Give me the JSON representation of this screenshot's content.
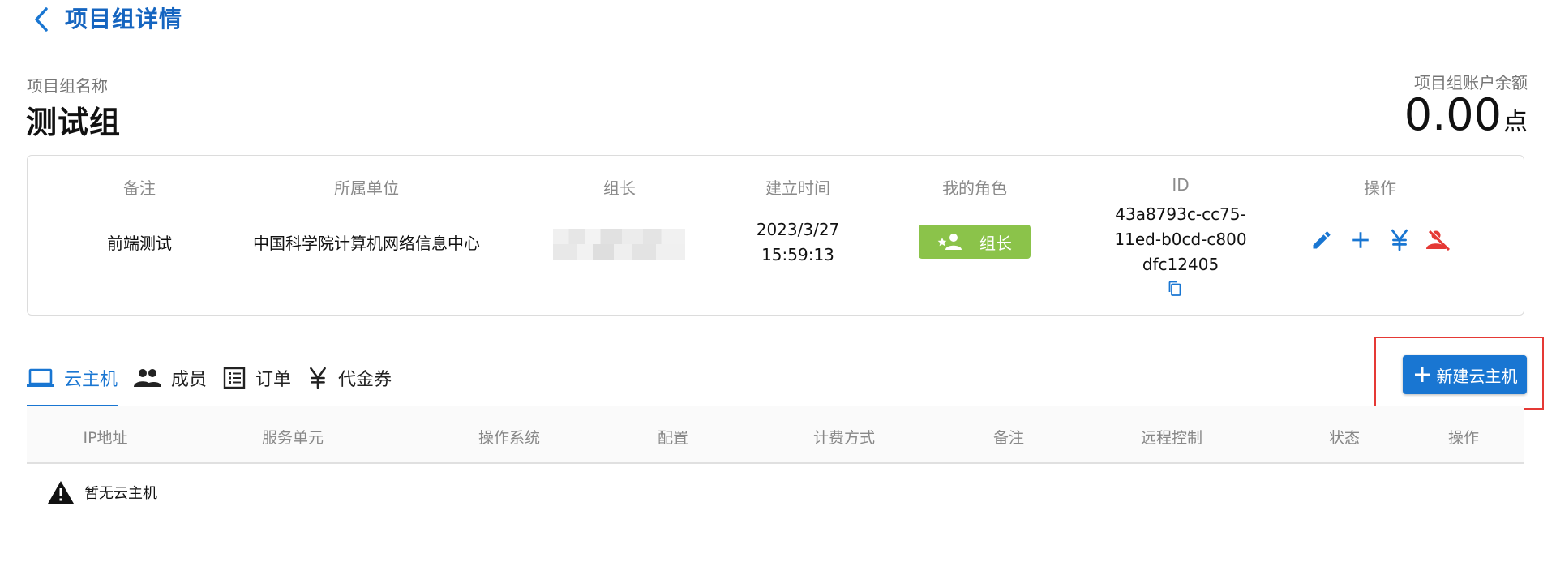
{
  "header": {
    "title": "项目组详情"
  },
  "group": {
    "name_label": "项目组名称",
    "name": "测试组",
    "balance_label": "项目组账户余额",
    "balance": "0.00",
    "balance_unit": "点"
  },
  "info": {
    "headers": {
      "remark": "备注",
      "org": "所属单位",
      "leader": "组长",
      "created": "建立时间",
      "role": "我的角色",
      "id": "ID",
      "ops": "操作"
    },
    "remark": "前端测试",
    "org": "中国科学院计算机网络信息中心",
    "created_date": "2023/3/27",
    "created_time": "15:59:13",
    "role": "组长",
    "id": "43a8793c-cc75-11ed-b0cd-c800dfc12405"
  },
  "tabs": [
    {
      "label": "云主机",
      "icon": "laptop-icon",
      "active": true
    },
    {
      "label": "成员",
      "icon": "people-icon",
      "active": false
    },
    {
      "label": "订单",
      "icon": "list-icon",
      "active": false
    },
    {
      "label": "代金券",
      "icon": "yen-icon",
      "active": false
    }
  ],
  "create_button": {
    "label": "新建云主机"
  },
  "table": {
    "columns": [
      "IP地址",
      "服务单元",
      "操作系统",
      "配置",
      "计费方式",
      "备注",
      "远程控制",
      "状态",
      "操作"
    ],
    "empty_text": "暂无云主机"
  },
  "colors": {
    "primary": "#1976d2",
    "title": "#1565c0",
    "role_badge": "#8bc34a",
    "danger": "#e53935"
  }
}
